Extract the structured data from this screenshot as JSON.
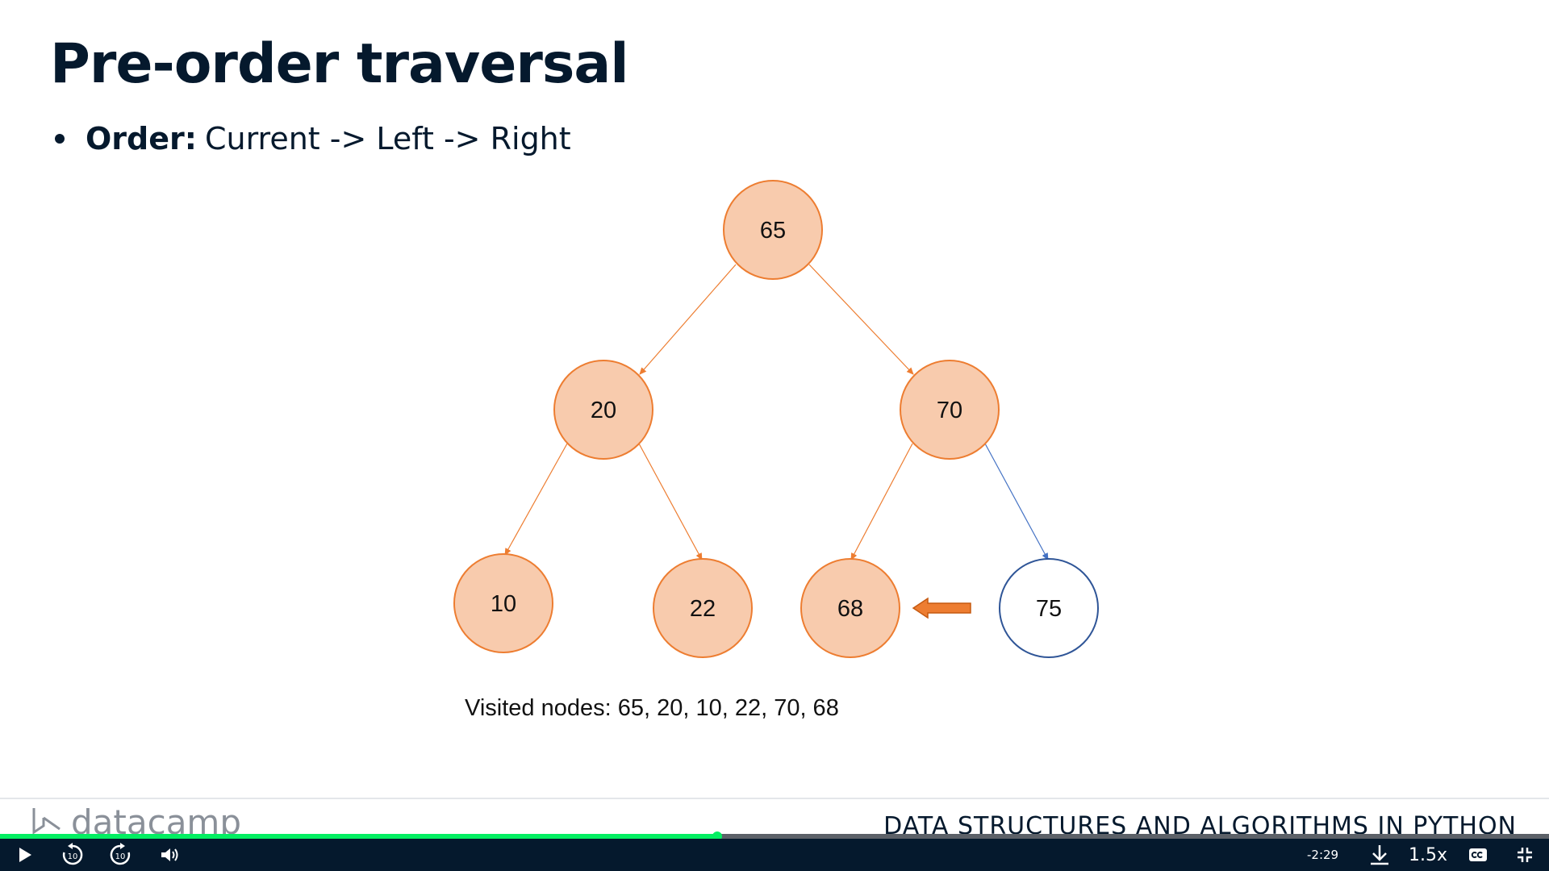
{
  "slide": {
    "title": "Pre-order traversal",
    "bullet_bold": "Order:",
    "bullet_text": "Current -> Left -> Right",
    "visited_text": "Visited nodes: 65, 20, 10, 22, 70, 68"
  },
  "tree": {
    "nodes": [
      {
        "id": "n65",
        "value": "65",
        "state": "visited"
      },
      {
        "id": "n20",
        "value": "20",
        "state": "visited"
      },
      {
        "id": "n70",
        "value": "70",
        "state": "visited"
      },
      {
        "id": "n10",
        "value": "10",
        "state": "visited"
      },
      {
        "id": "n22",
        "value": "22",
        "state": "visited"
      },
      {
        "id": "n68",
        "value": "68",
        "state": "visited"
      },
      {
        "id": "n75",
        "value": "75",
        "state": "unvisited"
      }
    ],
    "colors": {
      "visited_fill": "#f8cbad",
      "visited_stroke": "#ed7d31",
      "unvisited_stroke": "#2f5597",
      "edge_visited": "#ed7d31",
      "edge_unvisited": "#4472c4"
    }
  },
  "footer": {
    "brand": "datacamp",
    "course_title": "DATA STRUCTURES AND ALGORITHMS IN PYTHON"
  },
  "player": {
    "time_remaining": "-2:29",
    "speed": "1.5x",
    "skip_back_seconds": "10",
    "skip_forward_seconds": "10",
    "progress_fraction": 0.463,
    "accent": "#03ef62",
    "bar_bg": "#05192d",
    "icons": [
      "play-icon",
      "rewind-10-icon",
      "forward-10-icon",
      "volume-icon",
      "download-icon",
      "captions-icon",
      "exit-fullscreen-icon"
    ]
  }
}
